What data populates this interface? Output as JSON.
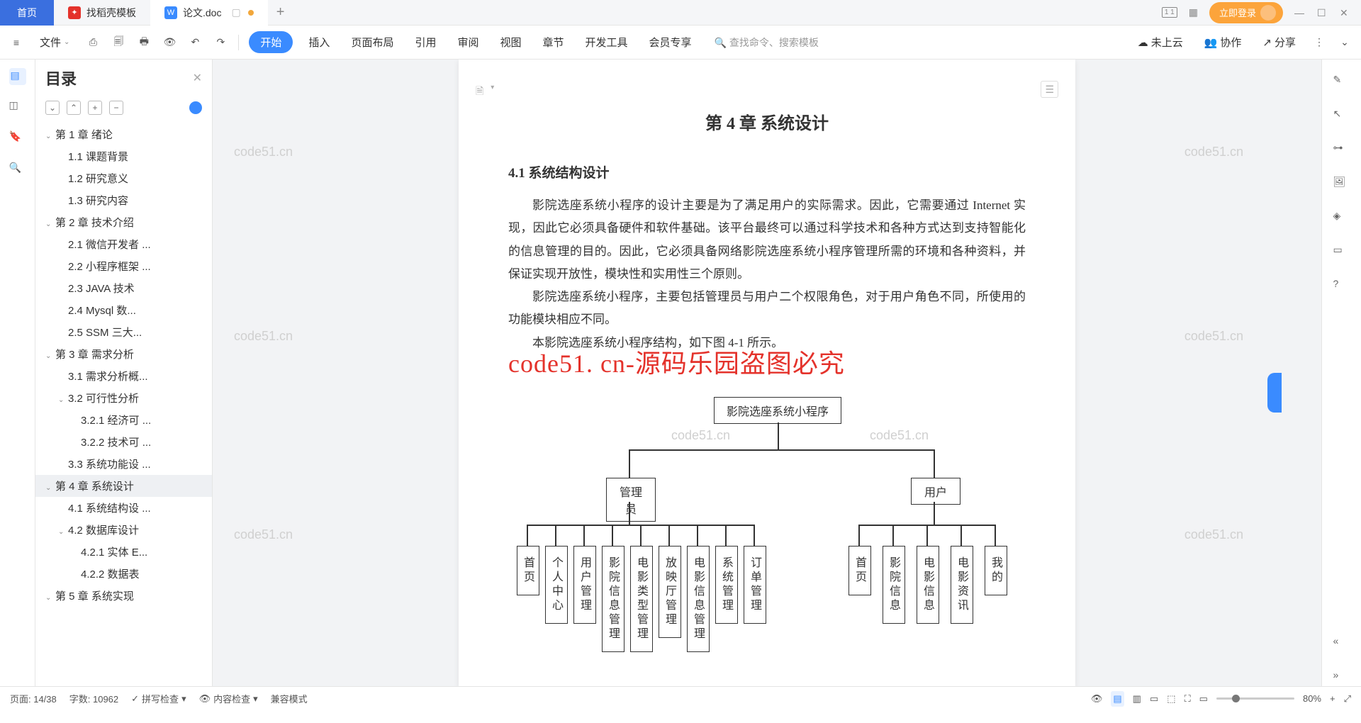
{
  "tabs": {
    "home": "首页",
    "tab1": "找稻壳模板",
    "tab2": "论文.doc"
  },
  "topright": {
    "login": "立即登录"
  },
  "ribbon": {
    "file": "文件",
    "start": "开始",
    "insert": "插入",
    "pagelayout": "页面布局",
    "reference": "引用",
    "review": "审阅",
    "view": "视图",
    "chapter": "章节",
    "devtools": "开发工具",
    "member": "会员专享",
    "search_ph": "查找命令、搜索模板",
    "notcloud": "未上云",
    "collab": "协作",
    "share": "分享"
  },
  "outline": {
    "title": "目录",
    "items": [
      {
        "t": "第 1 章  绪论",
        "l": 0,
        "chev": true
      },
      {
        "t": "1.1 课题背景",
        "l": 1
      },
      {
        "t": "1.2 研究意义",
        "l": 1
      },
      {
        "t": "1.3 研究内容",
        "l": 1
      },
      {
        "t": "第 2 章  技术介绍",
        "l": 0,
        "chev": true
      },
      {
        "t": "2.1 微信开发者 ...",
        "l": 1
      },
      {
        "t": "2.2 小程序框架 ...",
        "l": 1
      },
      {
        "t": "2.3 JAVA 技术",
        "l": 1
      },
      {
        "t": "2.4   Mysql 数...",
        "l": 1
      },
      {
        "t": "2.5 SSM 三大...",
        "l": 1
      },
      {
        "t": "第 3 章  需求分析",
        "l": 0,
        "chev": true
      },
      {
        "t": "3.1 需求分析概...",
        "l": 1
      },
      {
        "t": "3.2 可行性分析",
        "l": 1,
        "chev": true
      },
      {
        "t": "3.2.1 经济可 ...",
        "l": 2
      },
      {
        "t": "3.2.2 技术可 ...",
        "l": 2
      },
      {
        "t": "3.3 系统功能设 ...",
        "l": 1
      },
      {
        "t": "第 4 章  系统设计",
        "l": 0,
        "chev": true,
        "sel": true
      },
      {
        "t": "4.1 系统结构设 ...",
        "l": 1
      },
      {
        "t": "4.2 数据库设计",
        "l": 1,
        "chev": true
      },
      {
        "t": "4.2.1 实体 E...",
        "l": 2
      },
      {
        "t": "4.2.2 数据表",
        "l": 2
      },
      {
        "t": "第 5 章  系统实现",
        "l": 0,
        "chev": true
      }
    ]
  },
  "doc": {
    "chapter_title": "第 4 章  系统设计",
    "section_title": "4.1 系统结构设计",
    "p1": "影院选座系统小程序的设计主要是为了满足用户的实际需求。因此，它需要通过 Internet 实现，因此它必须具备硬件和软件基础。该平台最终可以通过科学技术和各种方式达到支持智能化的信息管理的目的。因此，它必须具备网络影院选座系统小程序管理所需的环境和各种资料，并保证实现开放性，模块性和实用性三个原则。",
    "p2": "影院选座系统小程序，主要包括管理员与用户二个权限角色，对于用户角色不同，所使用的功能模块相应不同。",
    "p3": "本影院选座系统小程序结构，如下图 4-1 所示。",
    "wm_red": "code51. cn-源码乐园盗图必究",
    "wm_gray": "code51.cn"
  },
  "diagram": {
    "root": "影院选座系统小程序",
    "admin": "管理员",
    "user": "用户",
    "admin_children": [
      "首页",
      "个人中心",
      "用户管理",
      "影院信息管理",
      "电影类型管理",
      "放映厅管理",
      "电影信息管理",
      "系统管理",
      "订单管理"
    ],
    "user_children": [
      "首页",
      "影院信息",
      "电影信息",
      "电影资讯",
      "我的"
    ]
  },
  "status": {
    "page": "页面: 14/38",
    "words": "字数: 10962",
    "spell": "拼写检查",
    "content": "内容检查",
    "compat": "兼容模式",
    "zoom": "80%"
  }
}
